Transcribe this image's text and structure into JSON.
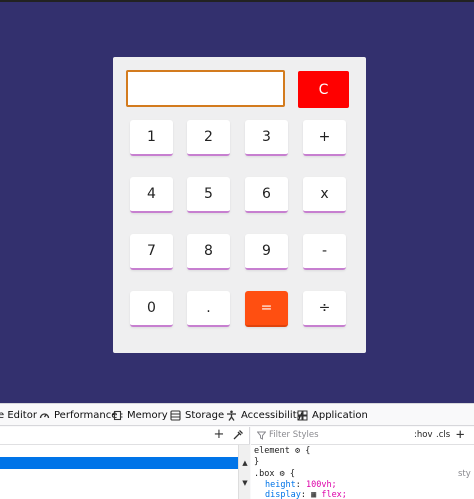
{
  "calculator": {
    "display_value": "",
    "clear_label": "C",
    "keys": [
      {
        "label": "1",
        "name": "key-1"
      },
      {
        "label": "2",
        "name": "key-2"
      },
      {
        "label": "3",
        "name": "key-3"
      },
      {
        "label": "+",
        "name": "key-plus"
      },
      {
        "label": "4",
        "name": "key-4"
      },
      {
        "label": "5",
        "name": "key-5"
      },
      {
        "label": "6",
        "name": "key-6"
      },
      {
        "label": "x",
        "name": "key-multiply"
      },
      {
        "label": "7",
        "name": "key-7"
      },
      {
        "label": "8",
        "name": "key-8"
      },
      {
        "label": "9",
        "name": "key-9"
      },
      {
        "label": "-",
        "name": "key-minus"
      },
      {
        "label": "0",
        "name": "key-0"
      },
      {
        "label": ".",
        "name": "key-decimal"
      },
      {
        "label": "=",
        "name": "key-equals"
      },
      {
        "label": "÷",
        "name": "key-divide"
      }
    ],
    "colors": {
      "page_bg": "#33306e",
      "clear": "#ff0000",
      "equals": "#ff4f11",
      "display_border": "#d37b1e",
      "key_underline": "#c77fd0"
    }
  },
  "devtools": {
    "tabs": [
      {
        "label": "e Editor",
        "icon": "style-editor-icon"
      },
      {
        "label": "Performance",
        "icon": "performance-icon"
      },
      {
        "label": "Memory",
        "icon": "memory-icon"
      },
      {
        "label": "Storage",
        "icon": "storage-icon"
      },
      {
        "label": "Accessibility",
        "icon": "accessibility-icon"
      },
      {
        "label": "Application",
        "icon": "application-icon"
      }
    ],
    "filter_placeholder": "Filter Styles",
    "hov_label": ":hov",
    "cls_label": ".cls",
    "rules": {
      "element_selector": "element",
      "element_open": "{",
      "element_close": "}",
      "box_selector": ".box",
      "box_open": "{",
      "prop1": "height",
      "val1": "100vh;",
      "prop2": "display",
      "val2": "flex;",
      "source_label": "sty"
    }
  }
}
